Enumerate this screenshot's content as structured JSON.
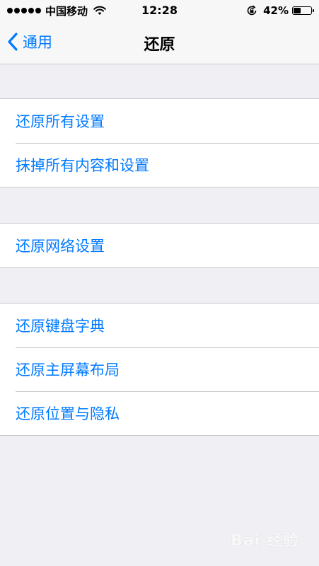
{
  "status_bar": {
    "carrier": "中国移动",
    "time": "12:28",
    "battery": "42%",
    "battery_level": 0.42,
    "icons": [
      "signal-dots",
      "wifi-icon",
      "rotation-lock-icon",
      "battery-icon"
    ]
  },
  "nav": {
    "back_label": "通用",
    "title": "还原"
  },
  "groups": [
    {
      "rows": [
        "还原所有设置",
        "抹掉所有内容和设置"
      ]
    },
    {
      "rows": [
        "还原网络设置"
      ]
    },
    {
      "rows": [
        "还原键盘字典",
        "还原主屏幕布局",
        "还原位置与隐私"
      ]
    }
  ],
  "watermark": "Bai 经验",
  "colors": {
    "accent": "#007aff",
    "background": "#efeff4",
    "separator": "#c8c7cc"
  }
}
